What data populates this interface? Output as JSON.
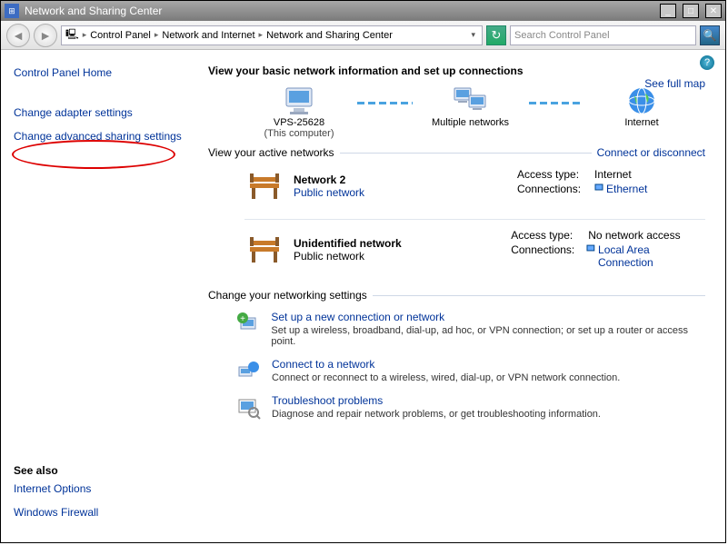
{
  "title": "Network and Sharing Center",
  "breadcrumb": {
    "root": "Control Panel",
    "mid": "Network and Internet",
    "leaf": "Network and Sharing Center"
  },
  "search": {
    "placeholder": "Search Control Panel"
  },
  "sidebar": {
    "home": "Control Panel Home",
    "adapter": "Change adapter settings",
    "advanced": "Change advanced sharing settings"
  },
  "main": {
    "heading": "View your basic network information and set up connections",
    "fullmap": "See full map",
    "nodes": {
      "pc": "VPS-25628",
      "pcsub": "(This computer)",
      "multi": "Multiple networks",
      "internet": "Internet"
    },
    "active_label": "View your active networks",
    "connect_link": "Connect or disconnect",
    "net1": {
      "name": "Network  2",
      "type": "Public network",
      "access_l": "Access type:",
      "access_v": "Internet",
      "conn_l": "Connections:",
      "conn_v": "Ethernet"
    },
    "net2": {
      "name": "Unidentified network",
      "type": "Public network",
      "access_l": "Access type:",
      "access_v": "No network access",
      "conn_l": "Connections:",
      "conn_v": "Local Area Connection"
    },
    "change_label": "Change your networking settings",
    "s1": {
      "t": "Set up a new connection or network",
      "d": "Set up a wireless, broadband, dial-up, ad hoc, or VPN connection; or set up a router or access point."
    },
    "s2": {
      "t": "Connect to a network",
      "d": "Connect or reconnect to a wireless, wired, dial-up, or VPN network connection."
    },
    "s3": {
      "t": "Troubleshoot problems",
      "d": "Diagnose and repair network problems, or get troubleshooting information."
    }
  },
  "seealso": {
    "h": "See also",
    "l1": "Internet Options",
    "l2": "Windows Firewall"
  }
}
